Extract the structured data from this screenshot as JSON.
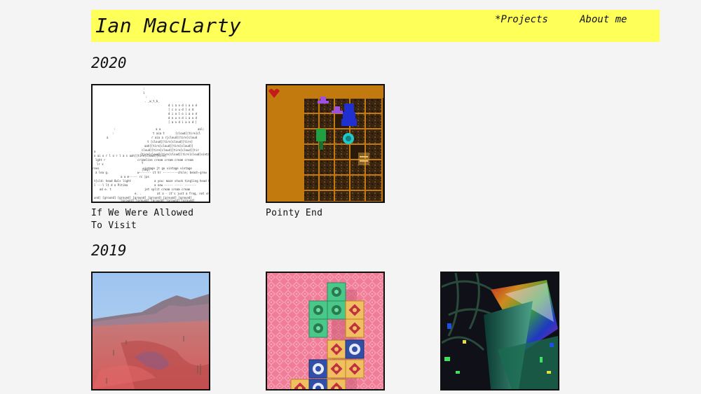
{
  "site": {
    "title": "Ian MacLarty",
    "nav": [
      {
        "label": "*Projects"
      },
      {
        "label": "About me"
      }
    ]
  },
  "sections": [
    {
      "year": "2020",
      "projects": [
        {
          "title": "If We Were Allowed To Visit",
          "thumb": "ascii-art-landscape"
        },
        {
          "title": "Pointy End",
          "thumb": "dungeon-game"
        }
      ]
    },
    {
      "year": "2019",
      "projects": [
        {
          "title": "",
          "thumb": "desert-landscape"
        },
        {
          "title": "",
          "thumb": "tile-puzzle"
        },
        {
          "title": "",
          "thumb": "glitch-art"
        }
      ]
    }
  ],
  "colors": {
    "background": "#f4f4f4",
    "header": "#ffff5a",
    "text": "#111111"
  }
}
